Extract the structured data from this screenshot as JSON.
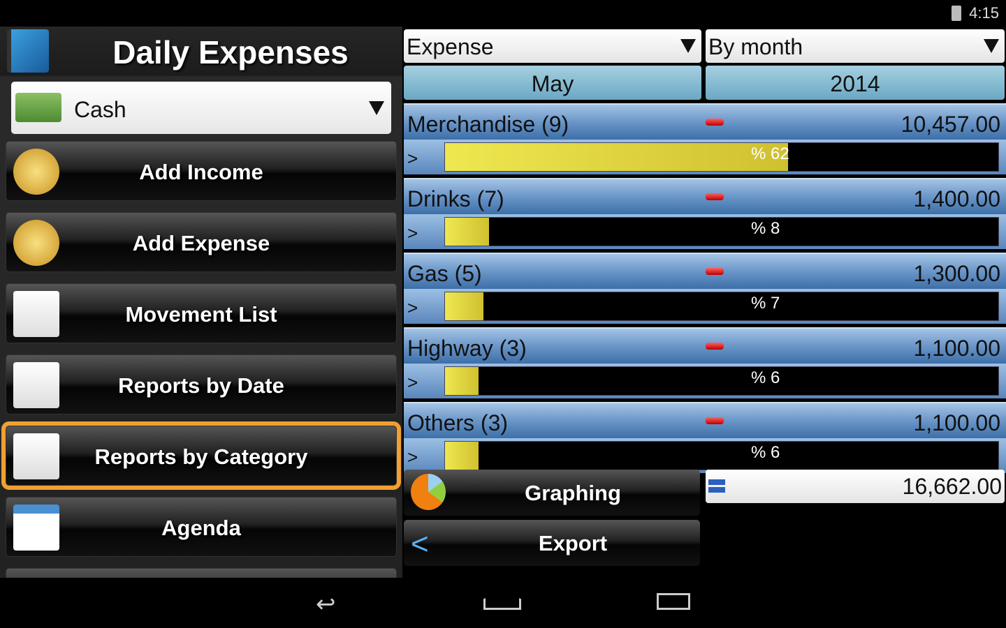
{
  "status": {
    "time": "4:15",
    "battery_icon": "battery-icon"
  },
  "app": {
    "title": "Daily Expenses"
  },
  "account": {
    "selected": "Cash"
  },
  "menu": [
    {
      "label": "Add Income",
      "icon": "coins-plus-icon"
    },
    {
      "label": "Add Expense",
      "icon": "coins-minus-icon"
    },
    {
      "label": "Movement List",
      "icon": "notepad-icon"
    },
    {
      "label": "Reports by Date",
      "icon": "report-chart-icon"
    },
    {
      "label": "Reports by Category",
      "icon": "report-pie-icon",
      "selected": true
    },
    {
      "label": "Agenda",
      "icon": "calendar-icon"
    }
  ],
  "filters": {
    "type": "Expense",
    "grouping": "By month",
    "month": "May",
    "year": "2014"
  },
  "categories": [
    {
      "name": "Merchandise (9)",
      "amount": "10,457.00",
      "percent_label": "% 62",
      "percent": 62
    },
    {
      "name": "Drinks (7)",
      "amount": "1,400.00",
      "percent_label": "% 8",
      "percent": 8
    },
    {
      "name": "Gas (5)",
      "amount": "1,300.00",
      "percent_label": "% 7",
      "percent": 7
    },
    {
      "name": "Highway (3)",
      "amount": "1,100.00",
      "percent_label": "% 6",
      "percent": 6
    },
    {
      "name": "Others (3)",
      "amount": "1,100.00",
      "percent_label": "% 6",
      "percent": 6
    }
  ],
  "expand_symbol": ">",
  "actions": {
    "graphing": "Graphing",
    "export": "Export"
  },
  "total": "16,662.00",
  "colors": {
    "selected_outline": "#f0a030",
    "bar_fill": "#e8e04a",
    "header_blue": "#6a96c8"
  }
}
